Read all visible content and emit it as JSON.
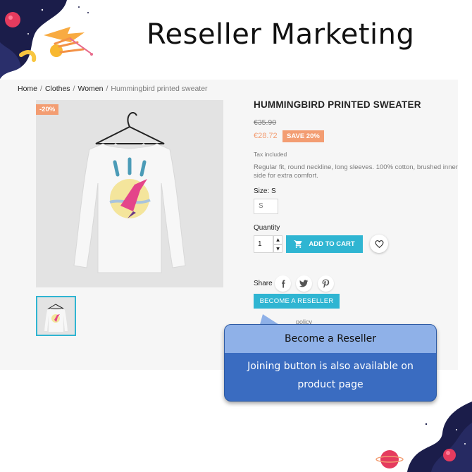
{
  "banner": {
    "title": "Reseller Marketing"
  },
  "breadcrumb": {
    "items": [
      "Home",
      "Clothes",
      "Women"
    ],
    "current": "Hummingbird printed sweater",
    "separator": "/"
  },
  "product": {
    "discount_flag": "-20%",
    "name": "HUMMINGBIRD PRINTED SWEATER",
    "regular_price": "€35.90",
    "current_price": "€28.72",
    "save_badge": "SAVE 20%",
    "tax_label": "Tax included",
    "description": "Regular fit, round neckline, long sleeves. 100% cotton, brushed inner side for extra comfort."
  },
  "options": {
    "size_label": "Size: S",
    "size_value": "S",
    "quantity_label": "Quantity",
    "quantity_value": "1"
  },
  "actions": {
    "add_to_cart": "ADD TO CART",
    "share_label": "Share",
    "reseller_button": "BECOME A RESELLER",
    "policy_text": "policy"
  },
  "callout": {
    "title": "Become a Reseller",
    "body": "Joining button is also available on product page"
  },
  "colors": {
    "accent": "#2fb5d2",
    "discount": "#f39d72",
    "callout_bg": "#3a6cc1",
    "callout_head": "#8fb1e8"
  },
  "icons": [
    "cart-icon",
    "heart-icon",
    "facebook-icon",
    "twitter-icon",
    "pinterest-icon",
    "spin-up-icon",
    "spin-down-icon"
  ]
}
